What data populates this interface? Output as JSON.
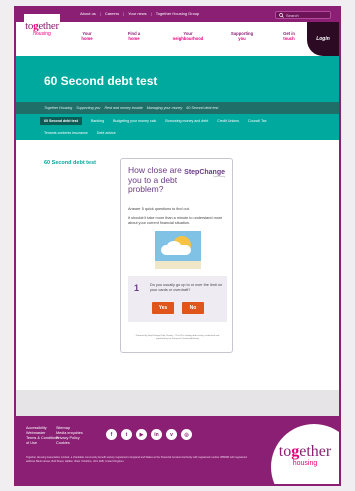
{
  "topbar": {
    "links": [
      "About us",
      "Careers",
      "Your news",
      "Together Housing Group"
    ],
    "search_placeholder": "Search"
  },
  "logo": {
    "word_pre": "to",
    "word_g": "g",
    "word_post": "ether",
    "sub": "housing"
  },
  "nav": [
    {
      "pre": "Your",
      "main": "home"
    },
    {
      "pre": "Find a",
      "main": "home"
    },
    {
      "pre": "Your",
      "main": "neighbourhood"
    },
    {
      "pre": "Supporting",
      "main": "you"
    },
    {
      "pre": "Get in",
      "main": "touch"
    }
  ],
  "login_label": "Login",
  "hero": {
    "title": "60 Second debt test"
  },
  "breadcrumb": [
    "Together Housing",
    "Supporting you",
    "Rent and money trouble",
    "Managing your money",
    "60 Second debt test"
  ],
  "tabs": {
    "row1": [
      "60 Second debt test",
      "Banking",
      "Budgeting your money calc",
      "Borrowing money and debt",
      "Credit Unions",
      "Council Tax"
    ],
    "row2": [
      "Tenants contents insurance",
      "Debt advice"
    ]
  },
  "content": {
    "left_title": "60 Second debt test",
    "card": {
      "title": "How close are you to a debt problem?",
      "brand": "StepChange",
      "brand_sub": "Debt charity",
      "intro1": "Answer 5 quick questions to find out.",
      "intro2": "It shouldn't take more than a minute to understand more about your current financial situation.",
      "question_number": "1",
      "question_text": "Do you usually go up to or over the limit on your cards or overdraft?",
      "yes_label": "Yes",
      "no_label": "No",
      "disclaimer": "Powered by StepChange Debt Charity – The UK's leading debt charity, authorised and regulated by the Financial Conduct Authority."
    }
  },
  "footer": {
    "links": [
      "Accessibility",
      "Sitemap",
      "Webmaster",
      "Media enquiries",
      "Terms & Conditions",
      "Privacy Policy",
      "of Use",
      "Cookies"
    ],
    "social": [
      {
        "icon": "facebook-icon",
        "glyph": "f"
      },
      {
        "icon": "twitter-icon",
        "glyph": "t"
      },
      {
        "icon": "youtube-icon",
        "glyph": "▶"
      },
      {
        "icon": "linkedin-icon",
        "glyph": "in"
      },
      {
        "icon": "vimeo-icon",
        "glyph": "v"
      },
      {
        "icon": "instagram-icon",
        "glyph": "◎"
      }
    ],
    "legal": "Together Housing Association Limited, a charitable community benefit society registered in England and Wales at the Financial Conduct Authority with registered number 28660R with registered address Bank House, Bull Street, Halifax, West Yorkshire, HX1 1EB, United Kingdom."
  },
  "colors": {
    "primary": "#8a1f74",
    "accent": "#e6007e",
    "teal": "#00a99d",
    "orange": "#e0561a",
    "purple_text": "#6b3a86"
  }
}
